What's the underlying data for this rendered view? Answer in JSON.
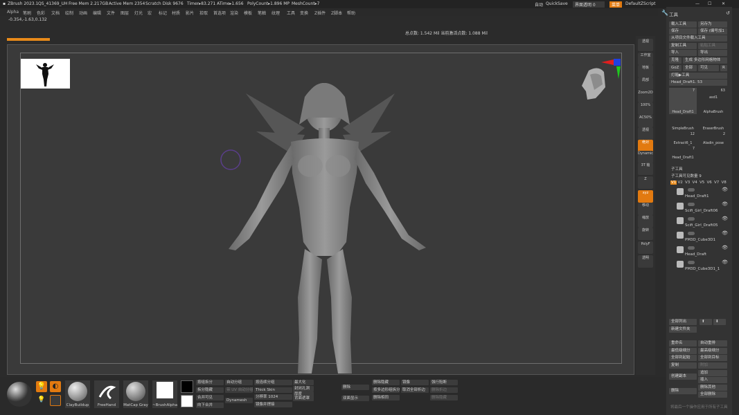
{
  "titlebar": {
    "app": "ZBrush 2023.1",
    "doc": "QS_41369_UH",
    "free_mem": "Free Mem 2.217GB",
    "active_mem": "Active Mem 2354",
    "scratch": "Scratch Disk 9676",
    "timer": "Timer▸83.271 ATime▸1.656",
    "polycount": "PolyCount▸1.896 MP",
    "meshcount": "MeshCount▸7",
    "auto_label": "自动",
    "quicksave": "QuickSave",
    "transparency": "界面透明 0",
    "menu_btn": "菜单",
    "zscript": "DefaultZScript"
  },
  "menubar": [
    "Alpha",
    "笔刷",
    "色彩",
    "文档",
    "绘制",
    "动画",
    "编辑",
    "文件",
    "图层",
    "灯光",
    "宏",
    "标记",
    "材质",
    "影片",
    "拾取",
    "首选项",
    "渲染",
    "模板",
    "笔触",
    "纹理",
    "工具",
    "变换",
    "Z插件",
    "Z脚本",
    "帮助"
  ],
  "coords": "-0.354,-1.63,0.132",
  "stats": "总点数: 1.542 Mil 当前激活点数: 1.088 Mil",
  "right_shelf": [
    "透视",
    "工作室",
    "地板",
    "局部",
    "Zoom2D",
    "100%",
    "AC50%",
    "透视",
    "绝对",
    "Dynamic",
    "3T 轴",
    "Z",
    "xyz",
    "移动",
    "缩放",
    "旋转",
    "PolyF",
    "透明"
  ],
  "tool_panel": {
    "title": "工具",
    "load": "载入工具",
    "save_as": "另存为",
    "save": "保存",
    "save_numbered": "保存 (编号加1",
    "load_from_project": "从项目文件载入工具",
    "copy_tool": "复制工具",
    "paste_tool": "粘贴工具",
    "import": "导入",
    "export": "导出",
    "clone": "克隆",
    "make_polymesh": "生成 多边形网格物体",
    "goz": "GoZ",
    "all": "全部",
    "visible": "可见",
    "r": "R",
    "lightbox": "灯箱▶工具",
    "current_tool": "Head_Draft1. 53",
    "tools": [
      {
        "name": "Head_Draft1",
        "count": "7"
      },
      {
        "name": "AlphaBrush",
        "count": "63",
        "sub": "asd1"
      },
      {
        "name": "SimpleBrush",
        "count": ""
      },
      {
        "name": "EraserBrush",
        "count": ""
      },
      {
        "name": "Extract6_1",
        "count": "12"
      },
      {
        "name": "Aladin_pose",
        "count": "2"
      },
      {
        "name": "Head_Draft1",
        "count": "7"
      }
    ],
    "subtool_title": "子工具",
    "subtool_count": "子工具可见数量 9",
    "versions": [
      "V1",
      "V2",
      "V3",
      "V4",
      "V5",
      "V6",
      "V7",
      "V8"
    ],
    "subtools": [
      "Head_Draft1",
      "Scifi_Girl_Draft06",
      "Scifi_Girl_Draft05",
      "PM3D_Cube3D1",
      "Head_Draft",
      "PM3D_Cube3D1_1"
    ],
    "list_all": "全部列出",
    "new_folder": "新建文件夹",
    "rename": "重命名",
    "auto_reorder": "自动重排",
    "lowest_sub": "最低级细分",
    "highest_sub": "最高级细分",
    "all_low": "全部到起始",
    "all_high": "全部到目标",
    "duplicate": "复制",
    "append": "附加",
    "create_copy": "创建副本",
    "add": "追加",
    "insert": "插入",
    "delete": "删除",
    "delete_other": "删除其他",
    "delete_all": "全部删除",
    "footer": "将最后一个操作应用于所有子工具"
  },
  "bottombar": {
    "tiles": [
      "ClayBuildup",
      "FreeHand",
      "MatCap Gray",
      "~BrushAlpha"
    ],
    "col1": [
      "按组拆分",
      "拆分隐藏",
      "合并可见",
      "向下合并"
    ],
    "col2": [
      "自动分组",
      "带 UV 自动分组",
      "Dynamesh"
    ],
    "col3": [
      "按连续分组",
      "Thick Skin",
      "分辨率 1024",
      "镜像并焊接"
    ],
    "col3b": [
      "最大化",
      "封闭孔洞",
      "厚度",
      "背面遮罩",
      "边缘环"
    ],
    "col4": [
      "删除",
      "双面显示"
    ],
    "col5": [
      "删除隐藏",
      "按多边形组拆分",
      "删除相同"
    ],
    "col6": [
      "镜像",
      "取消全部折边"
    ],
    "col7": [
      "强行阻断",
      "删除折边",
      "删除隐藏"
    ]
  },
  "colors": {
    "accent": "#e88a1a",
    "panel": "#333333",
    "viewport": "#3a3a3a",
    "gizmo_red": "#e01e1e",
    "gizmo_green": "#1ec81e",
    "gizmo_blue": "#2040e0"
  }
}
